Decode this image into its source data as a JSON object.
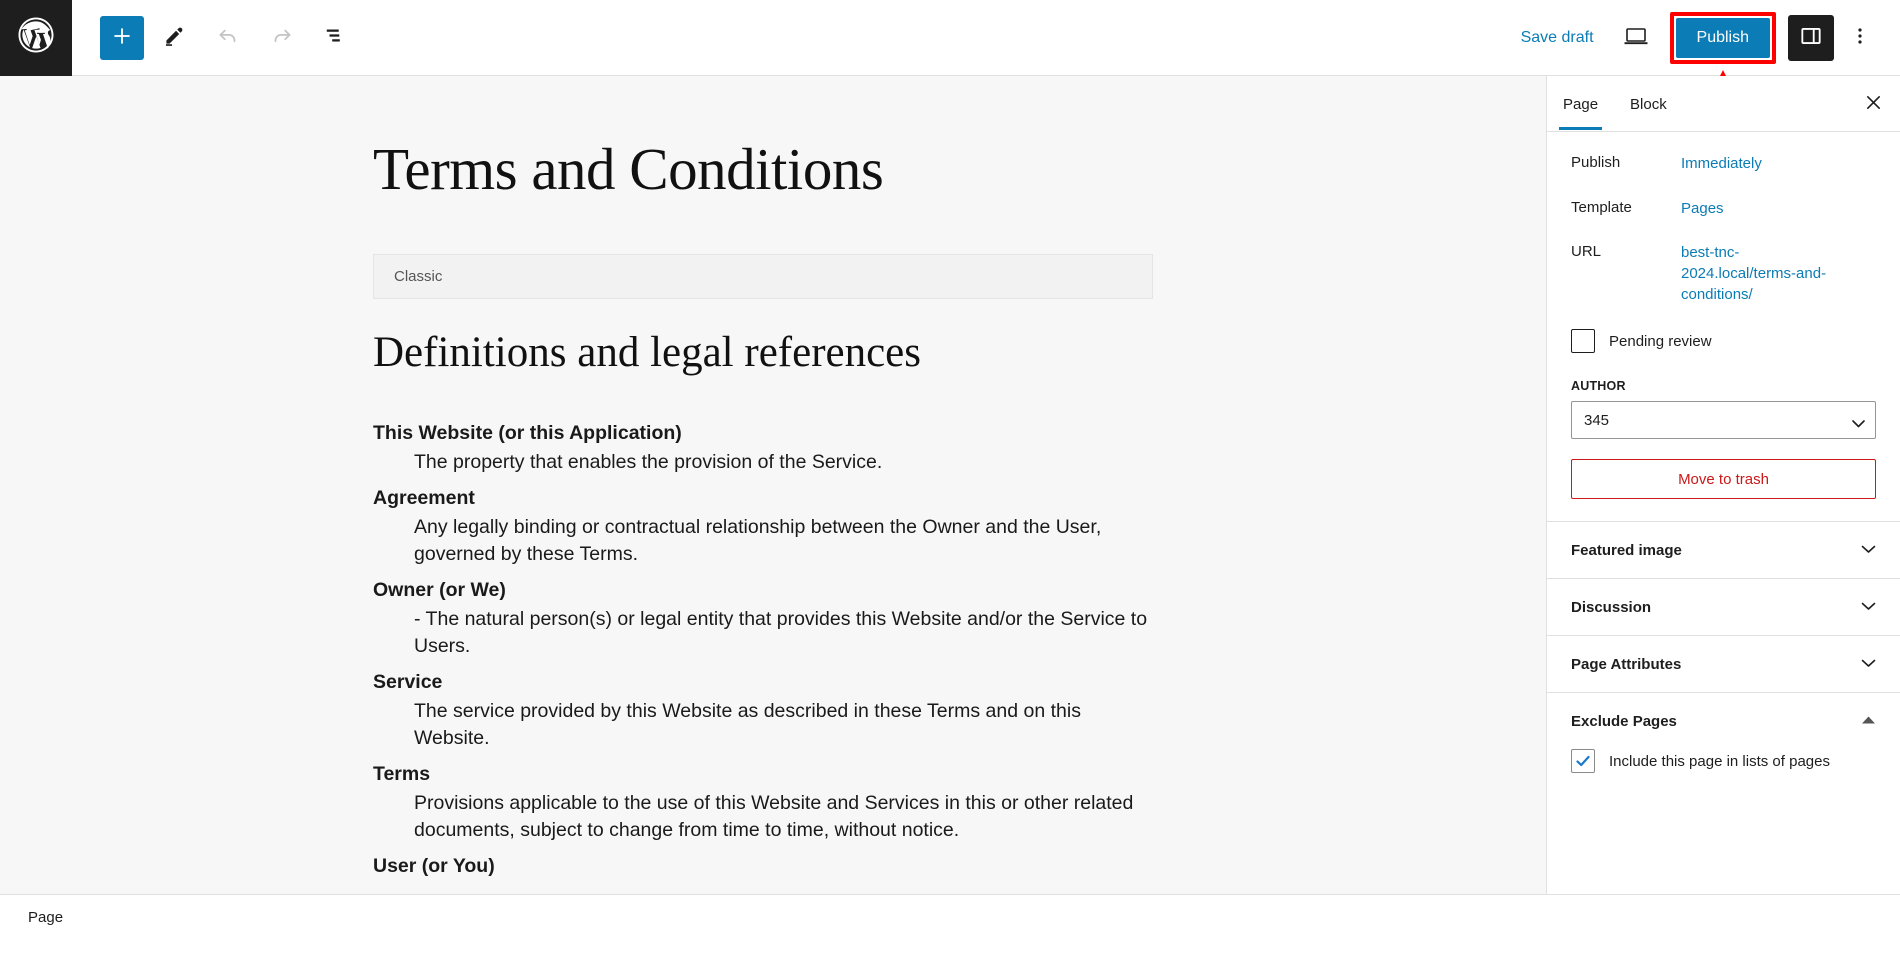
{
  "topbar": {
    "logo_icon": "wordpress-logo-icon",
    "add_block_icon": "plus-icon",
    "edit_icon": "pencil-icon",
    "undo_icon": "undo-arrow-icon",
    "redo_icon": "redo-arrow-icon",
    "list_view_icon": "document-overview-icon",
    "save_draft_label": "Save draft",
    "preview_icon": "desktop-preview-icon",
    "publish_label": "Publish",
    "sidebar_toggle_icon": "settings-sidebar-icon",
    "more_options_icon": "three-dots-vertical-icon",
    "highlight_color": "#ff0000",
    "accent_color": "#0b7cb5"
  },
  "editor": {
    "title": "Terms and Conditions",
    "classic_block_label": "Classic",
    "section_heading": "Definitions and legal references",
    "definitions": [
      {
        "term": "This Website (or this Application)",
        "description": "The property that enables the provision of the Service."
      },
      {
        "term": "Agreement",
        "description": "Any legally binding or contractual relationship between the Owner and the User, governed by these Terms."
      },
      {
        "term": "Owner (or We)",
        "description": "- The natural person(s) or legal entity that provides this Website and/or the Service to Users."
      },
      {
        "term": "Service",
        "description": "The service provided by this Website as described in these Terms and on this Website."
      },
      {
        "term": "Terms",
        "description": "Provisions applicable to the use of this Website and Services in this or other related documents, subject to change from time to time, without notice."
      },
      {
        "term": "User (or You)",
        "description": ""
      }
    ]
  },
  "settings": {
    "tabs": [
      {
        "label": "Page",
        "active": true
      },
      {
        "label": "Block",
        "active": false
      }
    ],
    "close_icon": "close-icon",
    "rows": [
      {
        "label": "Publish",
        "value": "Immediately"
      },
      {
        "label": "Template",
        "value": "Pages"
      },
      {
        "label": "URL",
        "value": "best-tnc-2024.local/terms-and-conditions/"
      }
    ],
    "pending_review": {
      "label": "Pending review",
      "checked": false
    },
    "author": {
      "label": "AUTHOR",
      "value": "345"
    },
    "trash_label": "Move to trash",
    "trash_color": "#cc1818",
    "panels": [
      {
        "title": "Featured image",
        "expanded": false
      },
      {
        "title": "Discussion",
        "expanded": false
      },
      {
        "title": "Page Attributes",
        "expanded": false
      },
      {
        "title": "Exclude Pages",
        "expanded": true
      }
    ],
    "exclude_pages_checkbox": {
      "label": "Include this page in lists of pages",
      "checked": true
    }
  },
  "statusbar": {
    "breadcrumb": "Page"
  }
}
